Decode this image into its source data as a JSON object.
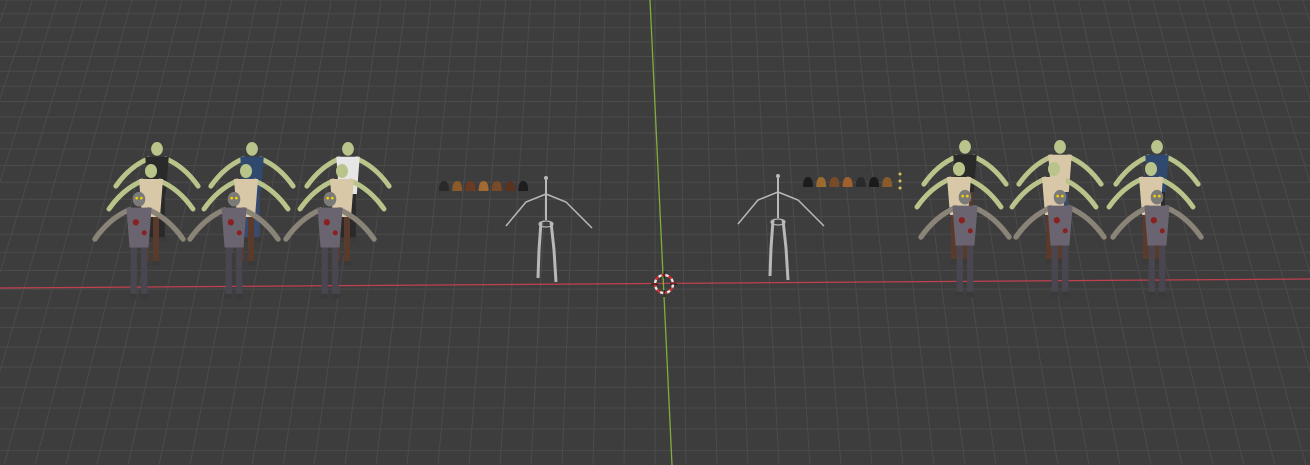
{
  "viewport": {
    "background": "#3d3d3d",
    "grid_color": "#4b4b4b",
    "x_axis_color": "#c0404f",
    "y_axis_color": "#7fae3b",
    "cursor_colors": [
      "#e8e8e8",
      "#d23030"
    ]
  },
  "objects": {
    "zombie_groups": [
      {
        "name": "zombie-group-left-1",
        "characters": 3
      },
      {
        "name": "zombie-group-left-2",
        "characters": 3
      },
      {
        "name": "zombie-group-left-3",
        "characters": 3
      },
      {
        "name": "zombie-group-right-1",
        "characters": 3
      },
      {
        "name": "zombie-group-right-2",
        "characters": 3
      },
      {
        "name": "zombie-group-right-3",
        "characters": 3
      }
    ],
    "armatures": [
      {
        "name": "armature-left"
      },
      {
        "name": "armature-right"
      }
    ],
    "hair_pieces_left": [
      "#2a2a2a",
      "#8a5a2a",
      "#6b3a22",
      "#a06a32",
      "#7a4a28",
      "#5a3220",
      "#1e1e1e"
    ],
    "hair_pieces_right": [
      "#1c1c1c",
      "#9a6a30",
      "#7a4a28",
      "#a0602e",
      "#2a2a2a",
      "#1a1a1a",
      "#8a5a2a"
    ],
    "skin_color": "#b9c48a",
    "shirt_colors": [
      "#2a2a2a",
      "#2f4a6e",
      "#e6e6e6",
      "#d8c8a8"
    ],
    "pants_colors": [
      "#2a2a2a",
      "#3a4a6a",
      "#5a3a2a"
    ],
    "zombie_cloth_color": "#6a6470",
    "blood_color": "#8a2020"
  }
}
